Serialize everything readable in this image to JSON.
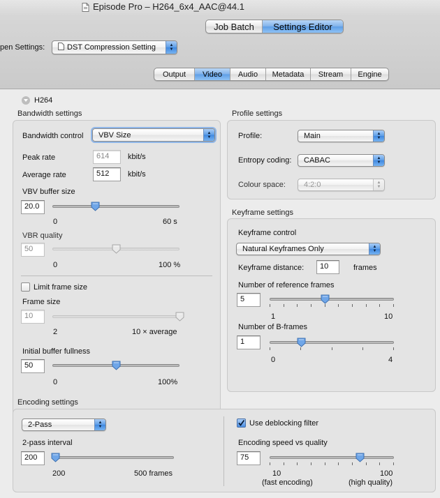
{
  "window": {
    "title": "Episode Pro – H264_6x4_AAC@44.1"
  },
  "mode_switcher": {
    "items": [
      "Job Batch",
      "Settings Editor"
    ],
    "selected": "Settings Editor"
  },
  "open_settings": {
    "label": "pen Settings:",
    "value": "DST Compression Setting"
  },
  "tabs": {
    "items": [
      "Output",
      "Video",
      "Audio",
      "Metadata",
      "Stream",
      "Engine"
    ],
    "selected": "Video"
  },
  "section": {
    "title": "H264"
  },
  "bandwidth": {
    "title": "Bandwidth settings",
    "control_label": "Bandwidth control",
    "control_value": "VBV Size",
    "peak_label": "Peak rate",
    "peak_value": "614",
    "peak_unit": "kbit/s",
    "avg_label": "Average rate",
    "avg_value": "512",
    "avg_unit": "kbit/s",
    "vbv_label": "VBV buffer size",
    "vbv_value": "20.0",
    "vbv_min": "0",
    "vbv_max": "60 s",
    "vbv_level": 0.333,
    "vbr_label": "VBR quality",
    "vbr_value": "50",
    "vbr_min": "0",
    "vbr_max": "100 %",
    "vbr_level": 0.5,
    "limit_label": "Limit frame size",
    "limit_checked": false,
    "frame_label": "Frame size",
    "frame_value": "10",
    "frame_min": "2",
    "frame_max": "10 × average",
    "frame_level": 1.0,
    "initial_label": "Initial buffer fullness",
    "initial_value": "50",
    "initial_min": "0",
    "initial_max": "100%",
    "initial_level": 0.5
  },
  "profile": {
    "title": "Profile settings",
    "profile_label": "Profile:",
    "profile_value": "Main",
    "entropy_label": "Entropy coding:",
    "entropy_value": "CABAC",
    "colour_label": "Colour space:",
    "colour_value": "4:2:0"
  },
  "keyframe": {
    "title": "Keyframe settings",
    "control_label": "Keyframe control",
    "control_value": "Natural Keyframes Only",
    "distance_label": "Keyframe distance:",
    "distance_value": "10",
    "distance_unit": "frames",
    "ref_label": "Number of reference frames",
    "ref_value": "5",
    "ref_min": "1",
    "ref_max": "10",
    "ref_level": 0.444,
    "b_label": "Number of B-frames",
    "b_value": "1",
    "b_min": "0",
    "b_max": "4",
    "b_level": 0.25
  },
  "encoding": {
    "title": "Encoding settings",
    "pass_value": "2-Pass",
    "interval_label": "2-pass interval",
    "interval_value": "200",
    "interval_min": "200",
    "interval_max": "500 frames",
    "interval_level": 0.0,
    "deblock_label": "Use deblocking filter",
    "deblock_checked": true,
    "speed_label": "Encoding speed vs quality",
    "speed_value": "75",
    "speed_min": "10",
    "speed_min_note": "(fast encoding)",
    "speed_max": "100",
    "speed_max_note": "(high quality)",
    "speed_level": 0.722
  },
  "colors": {
    "accent": "#5e9ee6",
    "knob": "#6fa6e8"
  }
}
